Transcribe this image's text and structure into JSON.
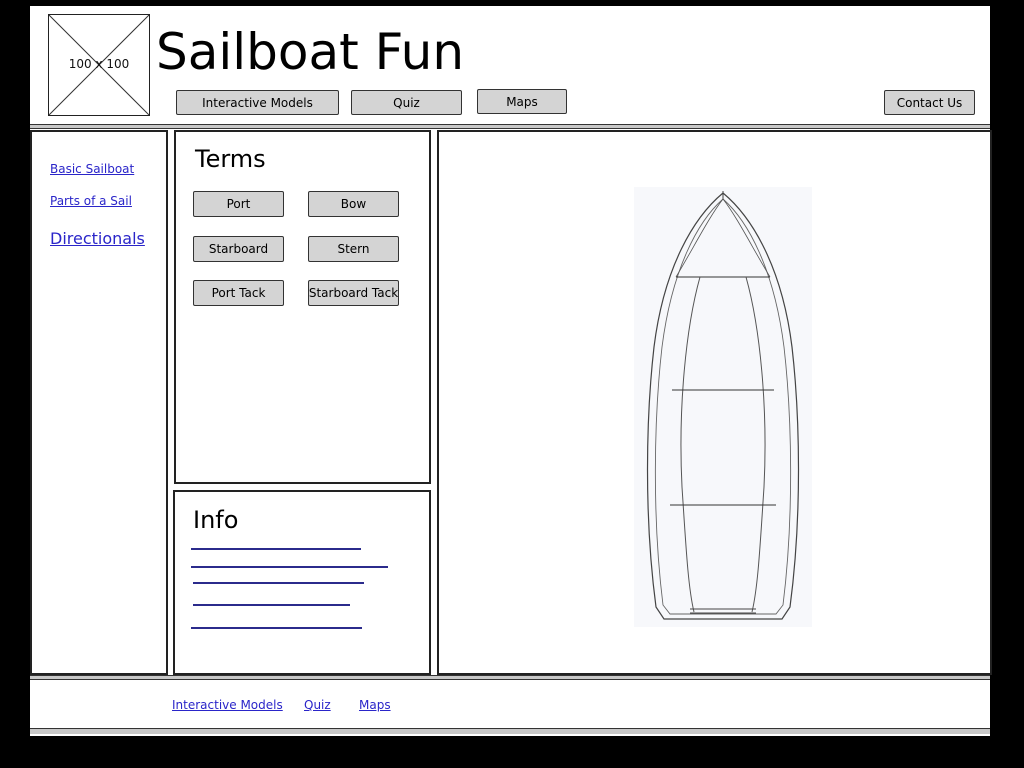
{
  "header": {
    "logo_placeholder": "100 x 100",
    "site_title": "Sailboat Fun"
  },
  "nav": {
    "interactive_models": "Interactive Models",
    "quiz": "Quiz",
    "maps": "Maps",
    "contact_us": "Contact Us"
  },
  "sidebar": {
    "items": [
      {
        "label": "Basic Sailboat"
      },
      {
        "label": "Parts of a Sail"
      },
      {
        "label": "Directionals"
      }
    ]
  },
  "terms": {
    "title": "Terms",
    "buttons": [
      {
        "label": "Port"
      },
      {
        "label": "Bow"
      },
      {
        "label": "Starboard"
      },
      {
        "label": "Stern"
      },
      {
        "label": "Port Tack"
      },
      {
        "label": "Starboard Tack"
      }
    ]
  },
  "info": {
    "title": "Info"
  },
  "footer": {
    "links": [
      {
        "label": "Interactive Models"
      },
      {
        "label": "Quiz"
      },
      {
        "label": "Maps"
      }
    ]
  }
}
